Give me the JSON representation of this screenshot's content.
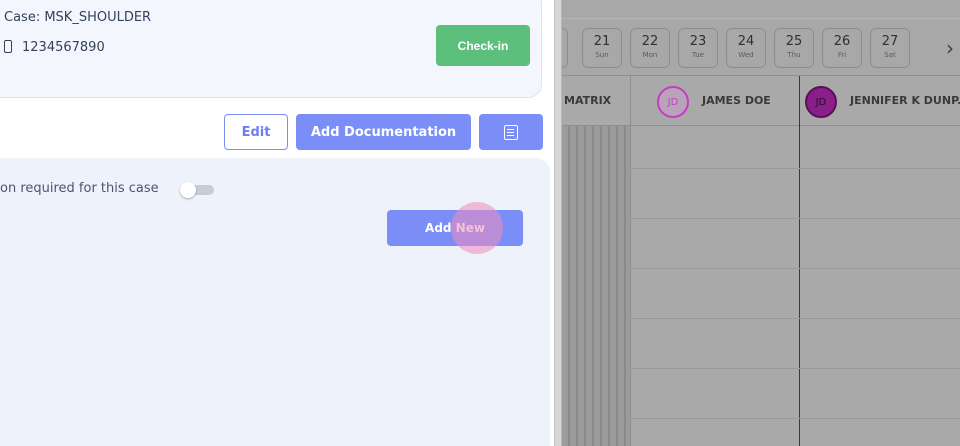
{
  "case": {
    "title": "Case: MSK_SHOULDER",
    "phone": "1234567890",
    "checkin_label": "Check-in"
  },
  "actions": {
    "edit_label": "Edit",
    "add_documentation_label": "Add Documentation",
    "document_icon": "document-icon"
  },
  "authorization": {
    "text": "on required for this case",
    "toggle_on": false,
    "add_new_label": "Add New"
  },
  "calendar": {
    "dates": [
      {
        "num": "21",
        "day": "Sun"
      },
      {
        "num": "22",
        "day": "Mon"
      },
      {
        "num": "23",
        "day": "Tue"
      },
      {
        "num": "24",
        "day": "Wed"
      },
      {
        "num": "25",
        "day": "Thu"
      },
      {
        "num": "26",
        "day": "Fri"
      },
      {
        "num": "27",
        "day": "Sat"
      }
    ],
    "next_icon": "chevron-right-icon",
    "next_glyph": "›",
    "resources": [
      {
        "label": "MATRIX",
        "initials": ""
      },
      {
        "label": "JAMES DOE",
        "initials": "JD"
      },
      {
        "label": "JENNIFER K DUNP...",
        "initials": "JD"
      }
    ]
  },
  "colors": {
    "primary": "#7b8ef7",
    "success": "#5cbf7b",
    "avatar_james": "#c23fc2",
    "avatar_jennifer": "#8a1f8a"
  }
}
